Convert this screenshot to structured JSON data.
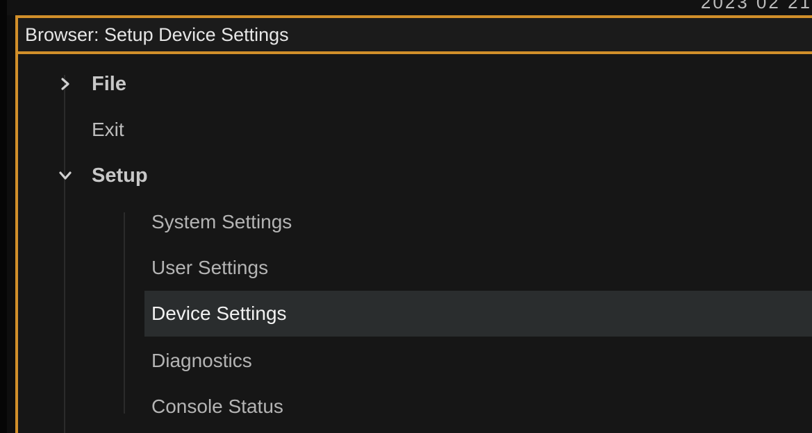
{
  "clock": {
    "text": "2023 02 21"
  },
  "window": {
    "title": "Browser: Setup Device Settings",
    "accent_color": "#d18f2a",
    "selection_color": "#2a2d2e"
  },
  "tree": {
    "file": {
      "label": "File",
      "expanded": false,
      "icon": "chevron-right-icon"
    },
    "exit": {
      "label": "Exit"
    },
    "setup": {
      "label": "Setup",
      "expanded": true,
      "icon": "chevron-down-icon",
      "children": [
        {
          "label": "System Settings",
          "selected": false
        },
        {
          "label": "User Settings",
          "selected": false
        },
        {
          "label": "Device Settings",
          "selected": true
        },
        {
          "label": "Diagnostics",
          "selected": false
        },
        {
          "label": "Console Status",
          "selected": false
        }
      ]
    }
  }
}
